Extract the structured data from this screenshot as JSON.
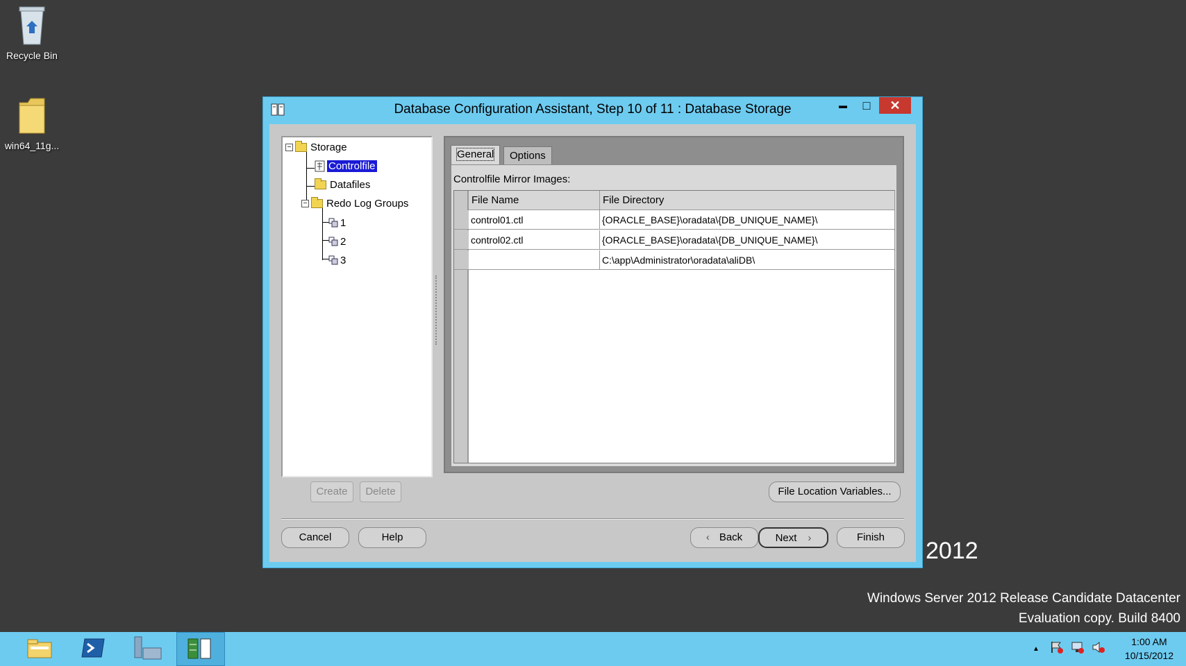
{
  "desktop": {
    "recycle_bin": "Recycle Bin",
    "folder": "win64_11g..."
  },
  "watermark": {
    "year": "2012",
    "line1": "Windows Server 2012 Release Candidate Datacenter",
    "line2": "Evaluation copy. Build 8400"
  },
  "window": {
    "title": "Database Configuration Assistant, Step 10 of 11 : Database Storage",
    "min_glyph": "▬",
    "max_glyph": "□",
    "close_glyph": "✕"
  },
  "tree": {
    "storage": "Storage",
    "controlfile": "Controlfile",
    "datafiles": "Datafiles",
    "redo_log_groups": "Redo Log Groups",
    "groups": [
      "1",
      "2",
      "3"
    ]
  },
  "tabs": {
    "general": "General",
    "options": "Options"
  },
  "general": {
    "caption": "Controlfile Mirror Images:",
    "columns": [
      "File Name",
      "File Directory"
    ],
    "rows": [
      [
        "control01.ctl",
        "{ORACLE_BASE}\\oradata\\{DB_UNIQUE_NAME}\\"
      ],
      [
        "control02.ctl",
        "{ORACLE_BASE}\\oradata\\{DB_UNIQUE_NAME}\\"
      ],
      [
        "",
        "C:\\app\\Administrator\\oradata\\aliDB\\"
      ]
    ]
  },
  "buttons": {
    "create": "Create",
    "delete": "Delete",
    "file_location_variables": "File Location Variables...",
    "cancel": "Cancel",
    "help": "Help",
    "back": "Back",
    "next": "Next",
    "finish": "Finish"
  },
  "taskbar": {
    "time": "1:00 AM",
    "date": "10/15/2012",
    "tray_arrow": "▲"
  },
  "colors": {
    "taskbar": "#6ecbf0",
    "selection": "#1a1ad6",
    "close_button": "#c7382f"
  }
}
